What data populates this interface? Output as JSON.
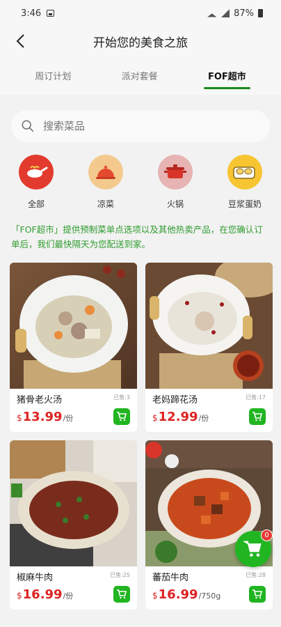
{
  "status": {
    "time": "3:46",
    "battery": "87%"
  },
  "header": {
    "title": "开始您的美食之旅"
  },
  "tabs": [
    {
      "label": "周订计划",
      "active": false
    },
    {
      "label": "派对套餐",
      "active": false
    },
    {
      "label": "FOF超市",
      "active": true
    }
  ],
  "search": {
    "placeholder": "搜索菜品"
  },
  "categories": [
    {
      "label": "全部",
      "icon": "wok-icon",
      "color": "#e23b2e"
    },
    {
      "label": "凉菜",
      "icon": "cloche-icon",
      "color": "#f4c98e"
    },
    {
      "label": "火锅",
      "icon": "hotpot-icon",
      "color": "#e7b3b3"
    },
    {
      "label": "豆浆蛋奶",
      "icon": "eggs-icon",
      "color": "#f7c531"
    }
  ],
  "notice": "「FOF超市」提供预制菜单点选项以及其他热卖产品，在您确认订单后，我们最快隔天为您配送到家。",
  "products": [
    {
      "name": "猪骨老火汤",
      "sold": "已售:3",
      "currency": "$",
      "price": "13.99",
      "unit": "/份"
    },
    {
      "name": "老妈蹄花汤",
      "sold": "已售:17",
      "currency": "$",
      "price": "12.99",
      "unit": "/份"
    },
    {
      "name": "椒麻牛肉",
      "sold": "已售:25",
      "currency": "$",
      "price": "16.99",
      "unit": "/份"
    },
    {
      "name": "蕃茄牛肉",
      "sold": "已售:28",
      "currency": "$",
      "price": "16.99",
      "unit": "/750g"
    }
  ],
  "cart": {
    "count": "0"
  },
  "colors": {
    "accent": "#1a8a1a",
    "price": "#dd2222",
    "notice": "#2e9b2e"
  }
}
